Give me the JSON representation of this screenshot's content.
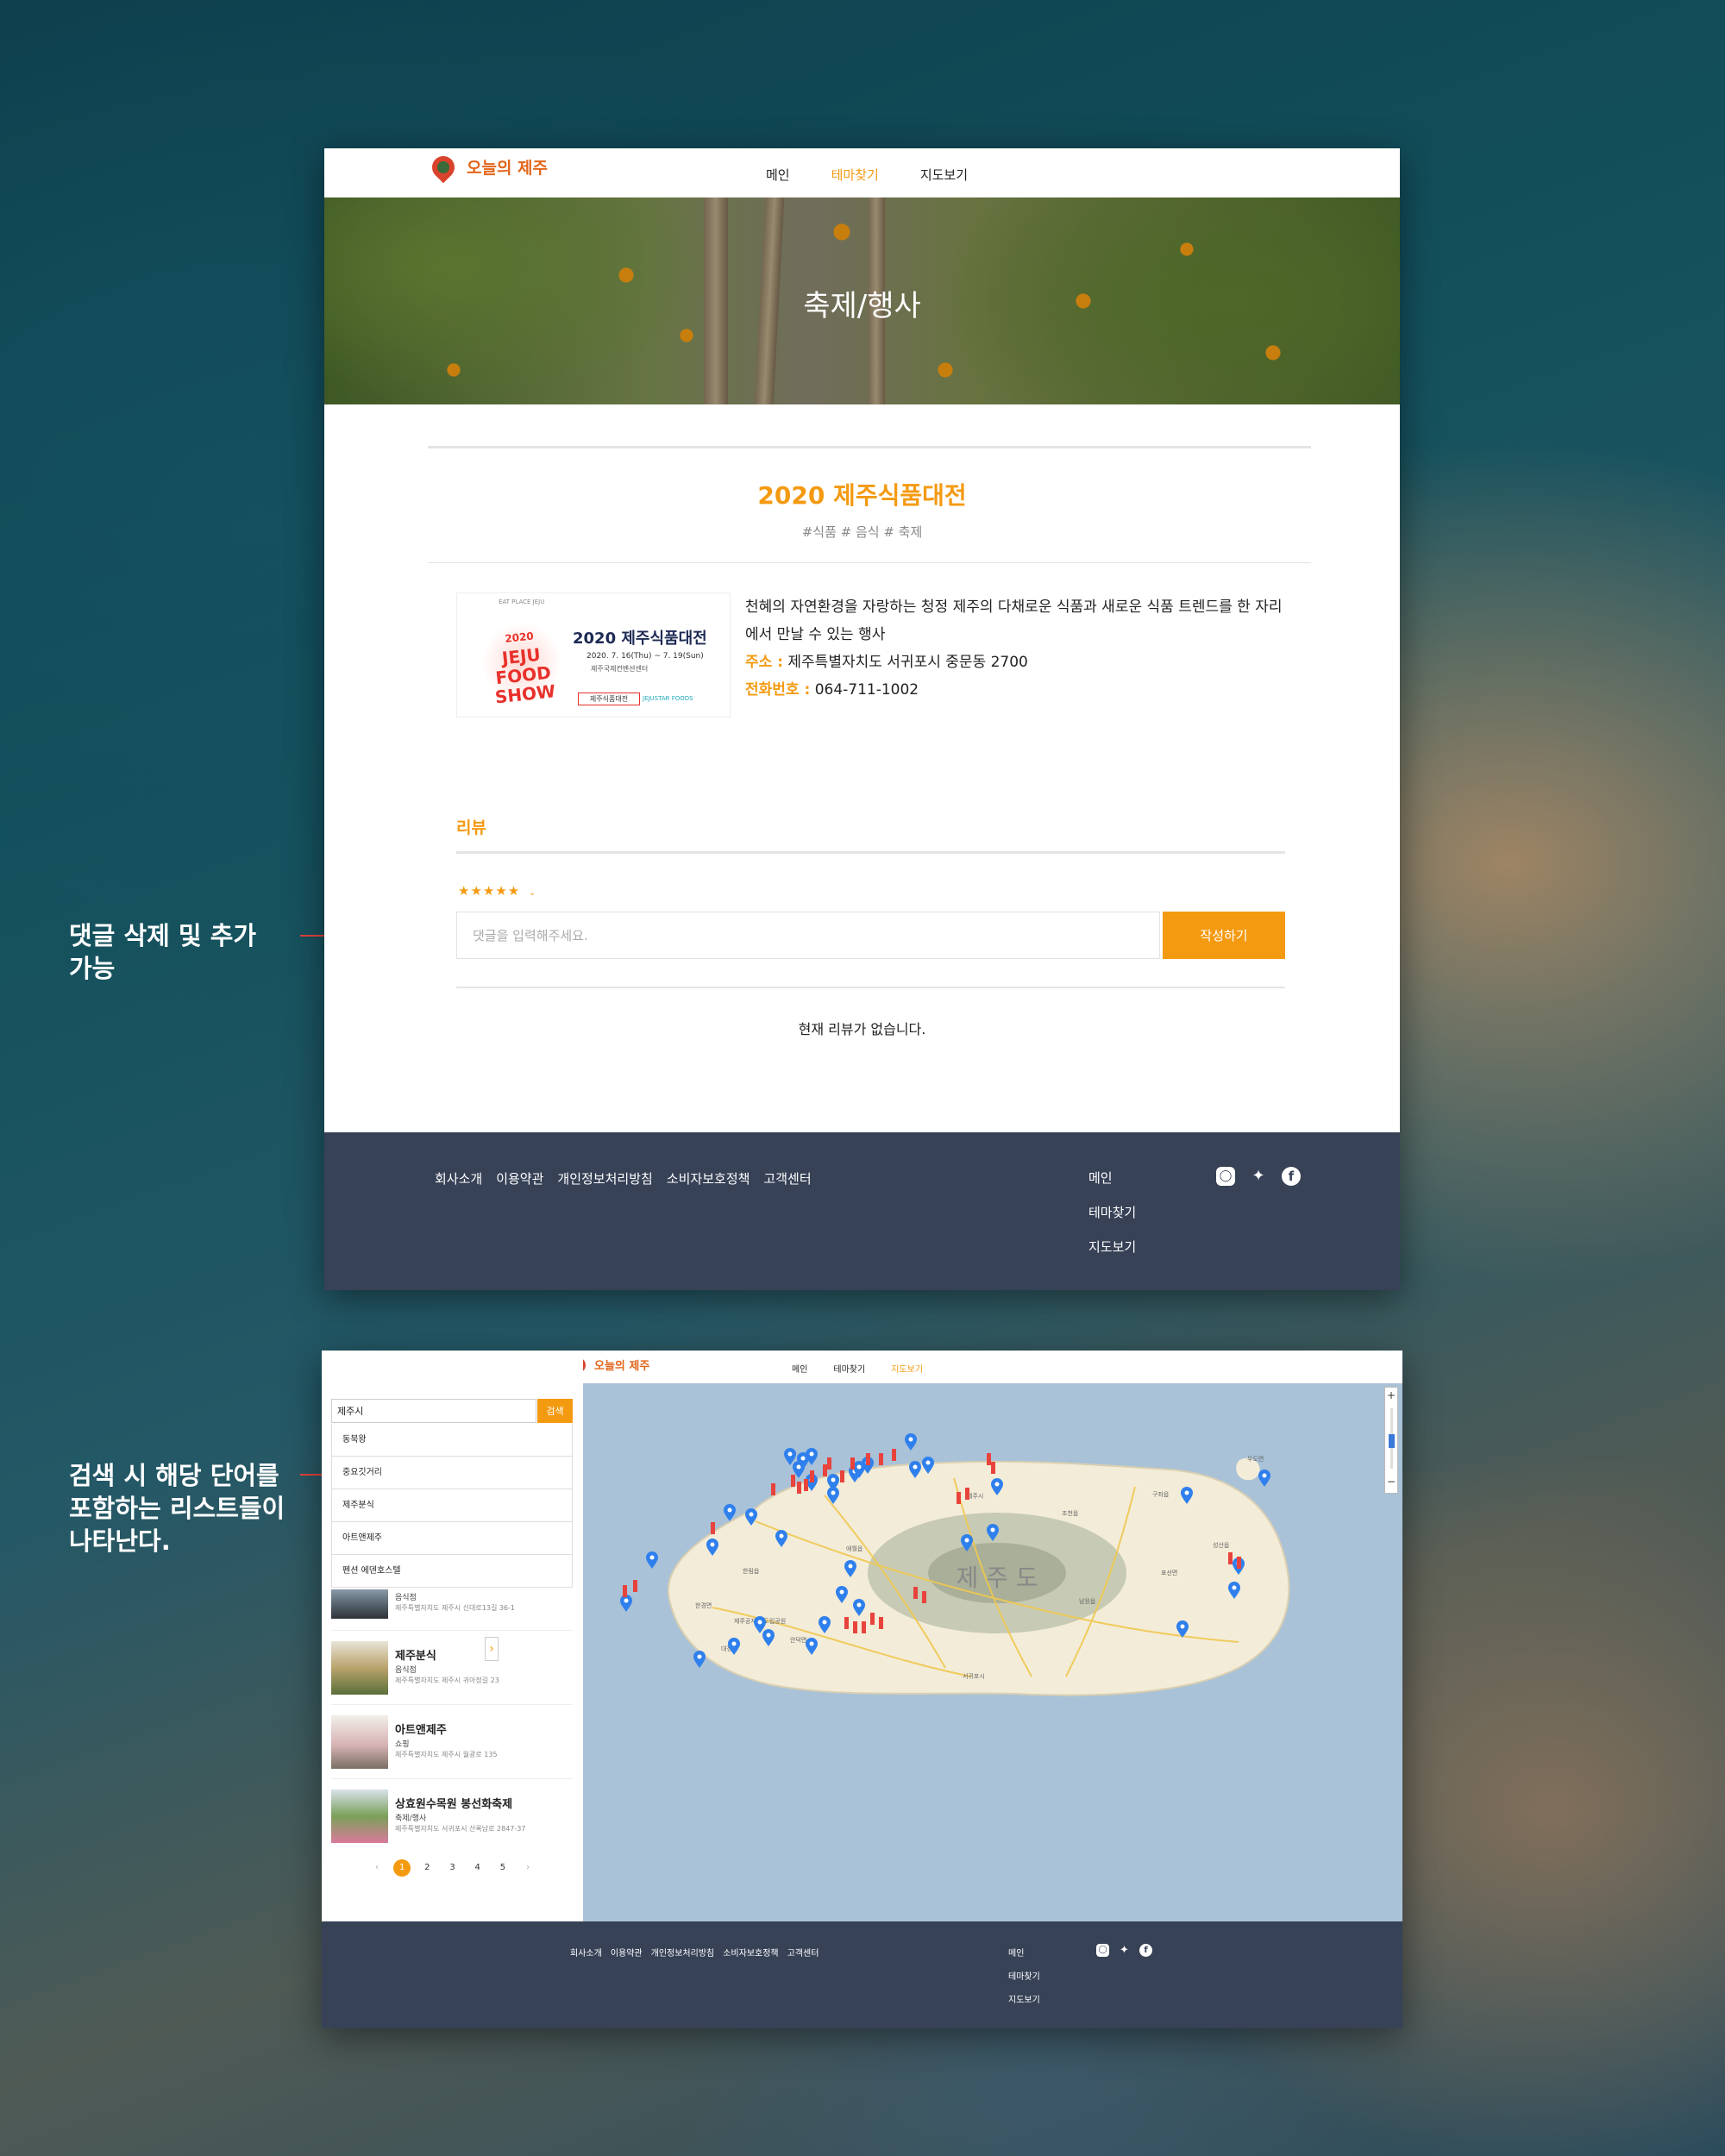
{
  "annotations": {
    "comment": "댓글 삭제 및 추가 가능",
    "search": "검색 시 해당 단어를 포함하는 리스트들이 나타난다."
  },
  "site": {
    "logo": "오늘의 제주",
    "nav": [
      "메인",
      "테마찾기",
      "지도보기"
    ],
    "footer_links": [
      "회사소개",
      "이용약관",
      "개인정보처리방침",
      "소비자보호정책",
      "고객센터"
    ],
    "footer_nav": [
      "메인",
      "테마찾기",
      "지도보기"
    ],
    "social_icons": [
      "instagram-icon",
      "twitter-icon",
      "facebook-icon"
    ]
  },
  "detail_page": {
    "hero_title": "축제/행사",
    "event_title": "2020 제주식품대전",
    "tags": "#식품 # 음식 # 축제",
    "poster": {
      "top": "EAT PLACE JEJU",
      "logo_year": "2020",
      "logo_text": "JEJU FOOD SHOW",
      "title": "2020 제주식품대전",
      "dates": "2020. 7. 16(Thu) ~ 7. 19(Sun)",
      "venue": "제주국제컨벤션센터",
      "button": "제주식품대전",
      "sponsor": "JEJUSTAR FOODS"
    },
    "description": "천혜의 자연환경을 자랑하는 청정 제주의 다채로운 식품과 새로운 식품 트렌드를 한 자리에서 만날 수 있는 행사",
    "address_label": "주소 :",
    "address": "제주특별자치도 서귀포시 중문동 2700",
    "phone_label": "전화번호 :",
    "phone": "064-711-1002",
    "review_heading": "리뷰",
    "rating_stars": "★★★★★",
    "rating_value": 5,
    "comment_placeholder": "댓글을 입력해주세요.",
    "submit_label": "작성하기",
    "empty_reviews": "현재 리뷰가 없습니다."
  },
  "map_page": {
    "search_value": "제주시",
    "search_button": "검색",
    "suggestions": [
      "동북왕",
      "중요깃거리",
      "제주분식",
      "아트앤제주",
      "펜션 에덴호스텔"
    ],
    "results": [
      {
        "name": "",
        "category": "음식점",
        "address": "제주특별자치도 제주시 신대로13길 36-1"
      },
      {
        "name": "제주분식",
        "category": "음식점",
        "address": "제주특별자치도 제주시 귀아정길 23"
      },
      {
        "name": "아트앤제주",
        "category": "쇼핑",
        "address": "제주특별자치도 제주시 월광로 135"
      },
      {
        "name": "상효원수목원 봉선화축제",
        "category": "축제/행사",
        "address": "제주특별자치도 서귀포시 산록남로 2847-37"
      }
    ],
    "pages": [
      "1",
      "2",
      "3",
      "4",
      "5"
    ],
    "current_page": "1",
    "map_island_label": "제 주 도",
    "map_places": [
      "제주시",
      "구좌읍",
      "조천읍",
      "애월읍",
      "한림읍",
      "성산읍",
      "표선면",
      "남원읍",
      "서귀포시",
      "한경면",
      "안덕면",
      "대정읍",
      "제주공자왕 도립공원",
      "우도면"
    ]
  }
}
